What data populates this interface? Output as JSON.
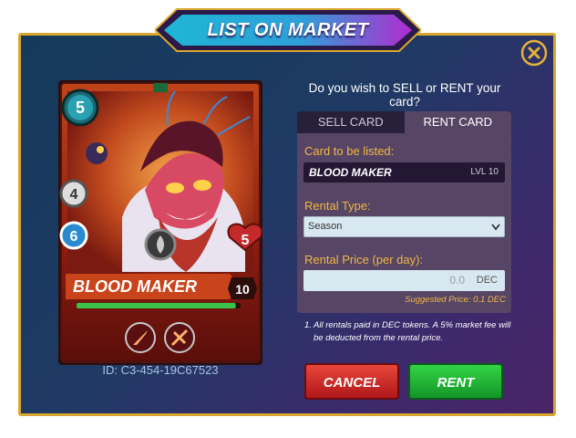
{
  "modal": {
    "title": "LIST ON MARKET",
    "question": "Do you wish to SELL or RENT your card?"
  },
  "card": {
    "name": "BLOOD MAKER",
    "mana": "5",
    "attack": "4",
    "speed": "6",
    "health": "5",
    "level": "10",
    "id_text": "ID: C3-454-19C67523"
  },
  "tabs": {
    "sell": "SELL CARD",
    "rent": "RENT CARD"
  },
  "form": {
    "card_label": "Card to be listed:",
    "card_name": "BLOOD MAKER",
    "card_level": "LVL 10",
    "rental_type_label": "Rental Type:",
    "rental_type_value": "Season",
    "rental_price_label": "Rental Price (per day):",
    "rental_price_value": "0.0",
    "price_unit": "DEC",
    "suggested": "Suggested Price: 0.1 DEC"
  },
  "note": {
    "num": "1.",
    "text": "All rentals paid in DEC tokens. A 5% market fee will be deducted from the rental price."
  },
  "buttons": {
    "cancel": "CANCEL",
    "rent": "RENT"
  },
  "icons": {
    "close": "close-icon",
    "ability1": "ability-dagger-icon",
    "ability2": "ability-sword-icon",
    "element": "fire-element-icon"
  }
}
